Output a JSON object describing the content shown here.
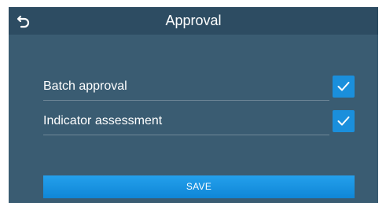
{
  "header": {
    "title": "Approval",
    "back_icon": "back-arrow-icon"
  },
  "options": [
    {
      "label": "Batch approval",
      "checked": true
    },
    {
      "label": "Indicator assessment",
      "checked": true
    }
  ],
  "actions": {
    "save_label": "SAVE"
  },
  "colors": {
    "background": "#3a5c72",
    "header": "#2d4c62",
    "accent": "#1a8fdc"
  }
}
